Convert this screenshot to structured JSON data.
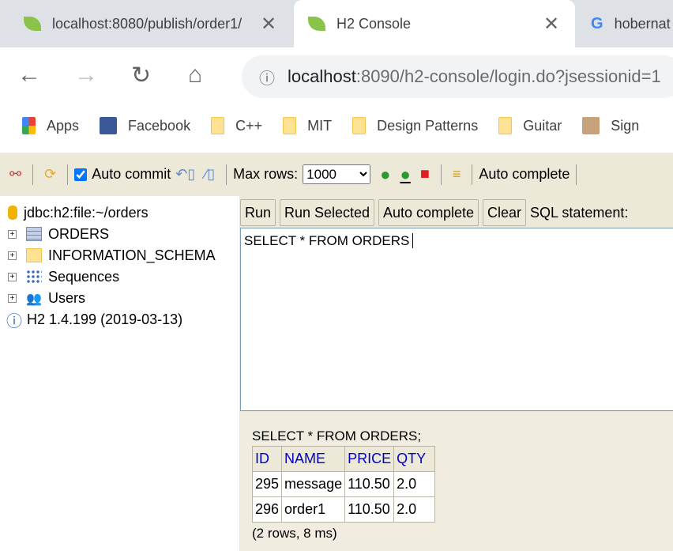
{
  "browser": {
    "tabs": [
      {
        "title": "localhost:8080/publish/order1/",
        "active": false
      },
      {
        "title": "H2 Console",
        "active": true
      },
      {
        "title": "hobernat",
        "active": false
      }
    ],
    "url_host": "localhost",
    "url_rest": ":8090/h2-console/login.do?jsessionid=1",
    "bookmarks": [
      "Apps",
      "Facebook",
      "C++",
      "MIT",
      "Design Patterns",
      "Guitar",
      "Sign"
    ]
  },
  "toolbar": {
    "auto_commit": "Auto commit",
    "auto_commit_checked": true,
    "max_rows_label": "Max rows:",
    "max_rows": "1000",
    "auto_complete": "Auto complete"
  },
  "tree": {
    "connection": "jdbc:h2:file:~/orders",
    "items": [
      "ORDERS",
      "INFORMATION_SCHEMA",
      "Sequences",
      "Users"
    ],
    "version": "H2 1.4.199 (2019-03-13)"
  },
  "editor": {
    "buttons": [
      "Run",
      "Run Selected",
      "Auto complete",
      "Clear"
    ],
    "label": "SQL statement:",
    "query": "SELECT * FROM ORDERS"
  },
  "results": {
    "statement": "SELECT * FROM ORDERS;",
    "columns": [
      "ID",
      "NAME",
      "PRICE",
      "QTY"
    ],
    "rows": [
      [
        "295",
        "message",
        "110.50",
        "2.0"
      ],
      [
        "296",
        "order1",
        "110.50",
        "2.0"
      ]
    ],
    "summary": "(2 rows, 8 ms)"
  }
}
